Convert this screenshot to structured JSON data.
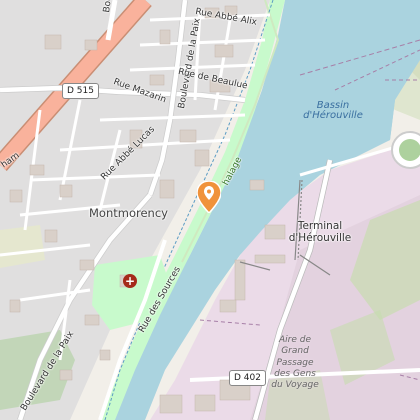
{
  "map": {
    "labels": {
      "boulevard_top": "Bou",
      "rue_abbe_alix": "Rue Abbé Alix",
      "bd_paix_north": "Boulevard de la Paix",
      "rue_beaulue": "Rue de Beaulue",
      "rue_mazarin": "Rue Mazarin",
      "rue_abbe_lucas": "Rue Abbé Lucas",
      "rue_sources": "Rue des Sources",
      "bd_paix_south": "Boulevard de la Paix",
      "ham": "ham",
      "montmorency": "Montmorency",
      "halage": "halage",
      "bassin": "Bassin\nd'Hérouville",
      "terminal": "Terminal\nd'Hérouville",
      "aire": "Aire de\nGrand\nPassage\ndes Gens\ndu Voyage"
    },
    "shields": {
      "d515": "D 515",
      "d402": "D 402"
    },
    "icons": {
      "location_pin": "location-pin-icon",
      "hospital": "hospital-icon"
    },
    "colors": {
      "water": "#aad3df",
      "industrial": "#ebdbe8",
      "park": "#c8facc",
      "wood": "#add19e",
      "primary_road": "#f9b29c",
      "residential": "#e0dfdf",
      "building": "#d9d0c9",
      "pin": "#f0923a"
    }
  }
}
